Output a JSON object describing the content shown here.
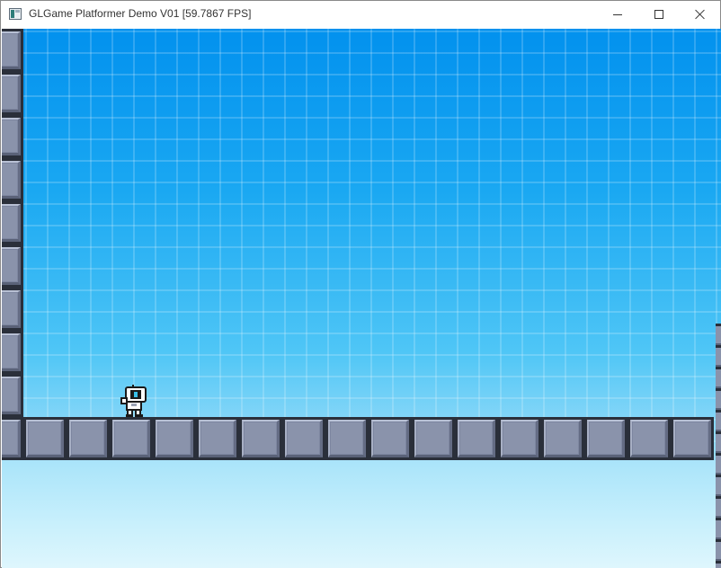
{
  "window": {
    "title": "GLGame Platformer Demo V01 [59.7867 FPS]",
    "icons": {
      "app": "app-icon",
      "minimize": "minimize-icon",
      "maximize": "maximize-icon",
      "close": "close-icon"
    }
  },
  "game": {
    "player": "robot-player-sprite",
    "tile": "stone-block-tile",
    "colors": {
      "sky_top": "#0291ee",
      "sky_bottom": "#c4eefb",
      "tile_face": "#8a93ab",
      "tile_outline": "#2a2f3a"
    }
  }
}
